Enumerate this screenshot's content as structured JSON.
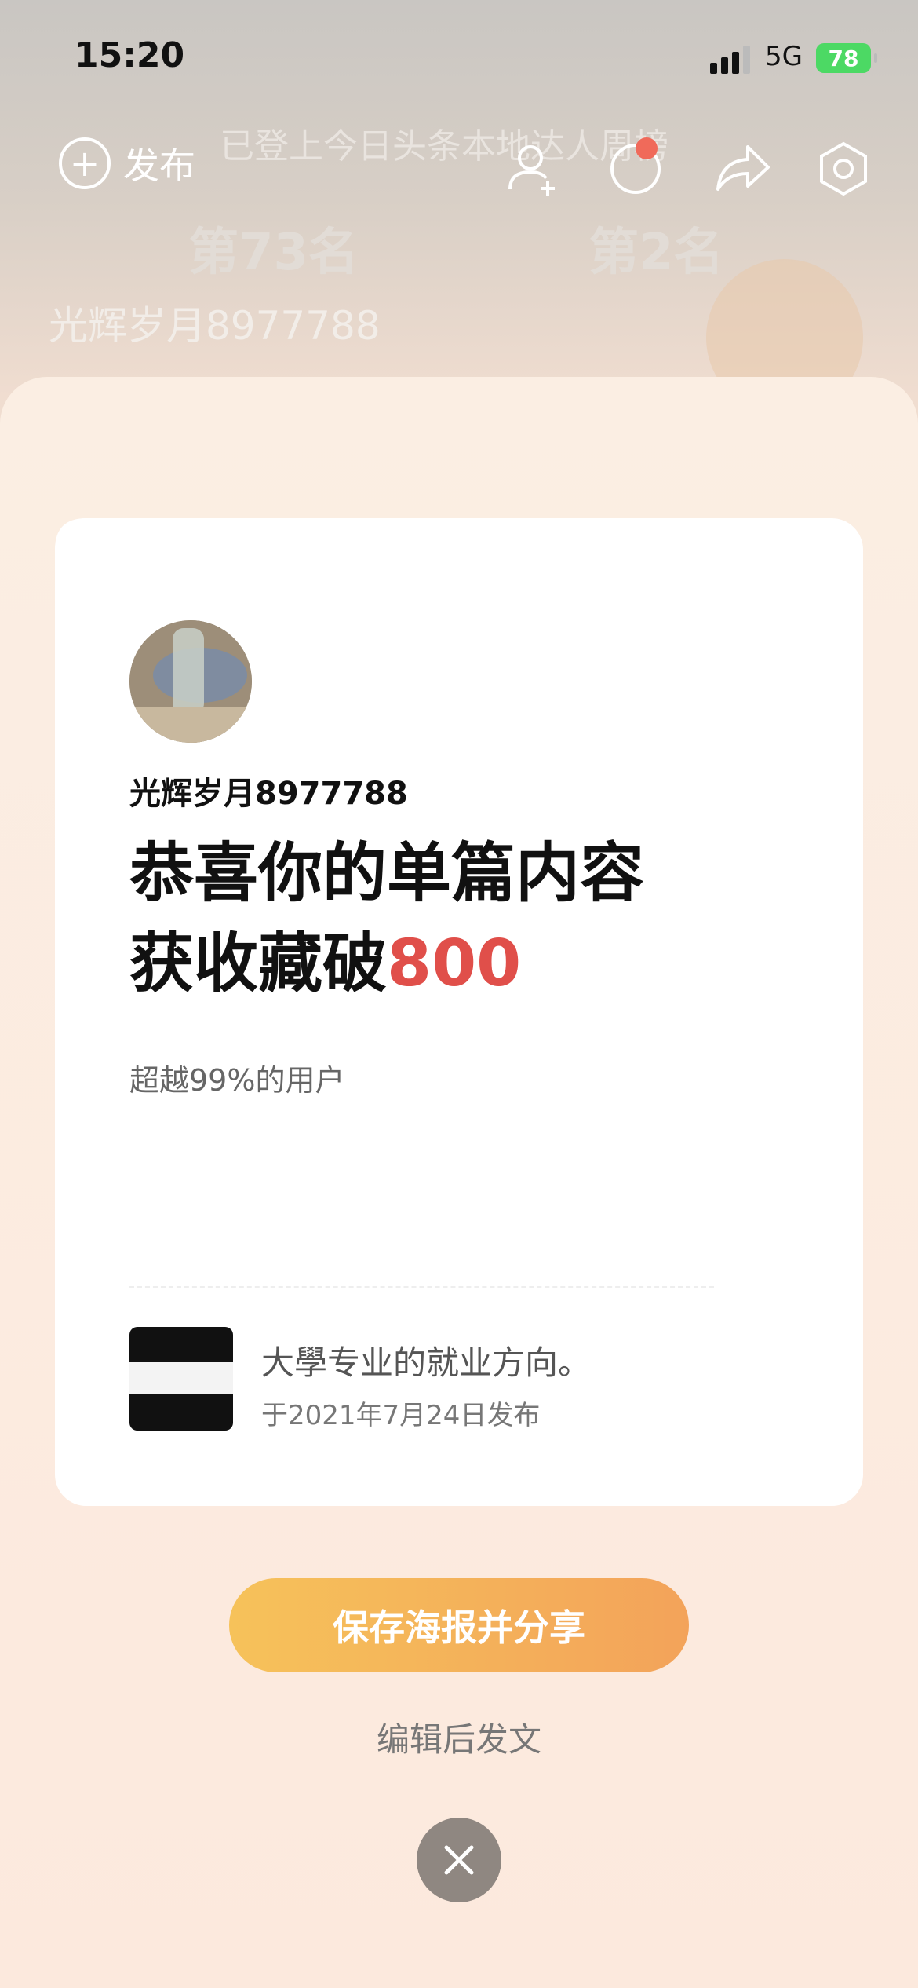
{
  "status_bar": {
    "time": "15:20",
    "network": "5G",
    "battery": "78"
  },
  "header": {
    "publish_label": "发布",
    "banner": "已登上今日头条本地达人周榜",
    "rank_left": "第73名",
    "rank_right": "第2名",
    "username": "光辉岁月8977788"
  },
  "card": {
    "username": "光辉岁月8977788",
    "headline_line1": "恭喜你的单篇内容",
    "headline_line2_prefix": "获收藏破",
    "headline_highlight": "800",
    "beat_text": "超越99%的用户",
    "article": {
      "title": "大學专业的就业方向。",
      "date": "于2021年7月24日发布"
    }
  },
  "actions": {
    "share_label": "保存海报并分享",
    "edit_label": "编辑后发文"
  },
  "colors": {
    "highlight": "#e04f4a",
    "button_start": "#f6c25a",
    "button_end": "#f3a35a"
  }
}
